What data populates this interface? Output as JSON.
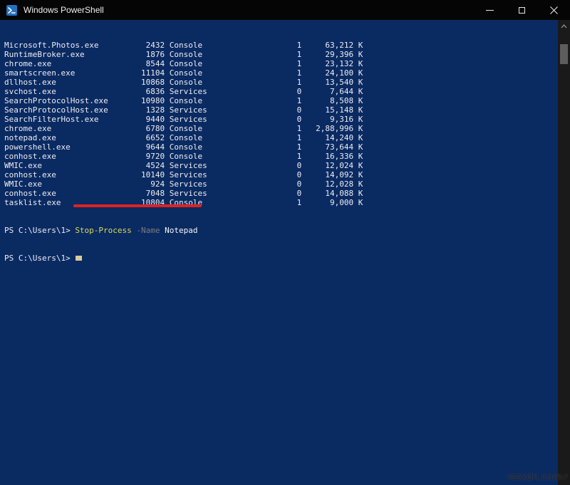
{
  "window": {
    "title": "Windows PowerShell"
  },
  "colors": {
    "console_background": "#0a2a62",
    "titlebar_background": "#050505",
    "console_text": "#eeedf0",
    "command_token": "#dcdc55",
    "parameter_token": "#7d7d7d",
    "argument_token": "#f7f7f7",
    "annotation_red": "#dd2222",
    "cursor": "#d9cb9b",
    "powershell_icon_blue": "#2671be"
  },
  "console": {
    "processes": [
      {
        "name": "Microsoft.Photos.exe",
        "pid": "2432",
        "session_name": "Console",
        "session_number": "1",
        "mem_usage": "63,212 K"
      },
      {
        "name": "RuntimeBroker.exe",
        "pid": "1876",
        "session_name": "Console",
        "session_number": "1",
        "mem_usage": "29,396 K"
      },
      {
        "name": "chrome.exe",
        "pid": "8544",
        "session_name": "Console",
        "session_number": "1",
        "mem_usage": "23,132 K"
      },
      {
        "name": "smartscreen.exe",
        "pid": "11104",
        "session_name": "Console",
        "session_number": "1",
        "mem_usage": "24,100 K"
      },
      {
        "name": "dllhost.exe",
        "pid": "10868",
        "session_name": "Console",
        "session_number": "1",
        "mem_usage": "13,540 K"
      },
      {
        "name": "svchost.exe",
        "pid": "6836",
        "session_name": "Services",
        "session_number": "0",
        "mem_usage": "7,644 K"
      },
      {
        "name": "SearchProtocolHost.exe",
        "pid": "10980",
        "session_name": "Console",
        "session_number": "1",
        "mem_usage": "8,508 K"
      },
      {
        "name": "SearchProtocolHost.exe",
        "pid": "1328",
        "session_name": "Services",
        "session_number": "0",
        "mem_usage": "15,148 K"
      },
      {
        "name": "SearchFilterHost.exe",
        "pid": "9440",
        "session_name": "Services",
        "session_number": "0",
        "mem_usage": "9,316 K"
      },
      {
        "name": "chrome.exe",
        "pid": "6780",
        "session_name": "Console",
        "session_number": "1",
        "mem_usage": "2,88,996 K"
      },
      {
        "name": "notepad.exe",
        "pid": "6652",
        "session_name": "Console",
        "session_number": "1",
        "mem_usage": "14,240 K"
      },
      {
        "name": "powershell.exe",
        "pid": "9644",
        "session_name": "Console",
        "session_number": "1",
        "mem_usage": "73,644 K"
      },
      {
        "name": "conhost.exe",
        "pid": "9720",
        "session_name": "Console",
        "session_number": "1",
        "mem_usage": "16,336 K"
      },
      {
        "name": "WMIC.exe",
        "pid": "4524",
        "session_name": "Services",
        "session_number": "0",
        "mem_usage": "12,024 K"
      },
      {
        "name": "conhost.exe",
        "pid": "10140",
        "session_name": "Services",
        "session_number": "0",
        "mem_usage": "14,092 K"
      },
      {
        "name": "WMIC.exe",
        "pid": "924",
        "session_name": "Services",
        "session_number": "0",
        "mem_usage": "12,028 K"
      },
      {
        "name": "conhost.exe",
        "pid": "7048",
        "session_name": "Services",
        "session_number": "0",
        "mem_usage": "14,088 K"
      },
      {
        "name": "tasklist.exe",
        "pid": "10804",
        "session_name": "Console",
        "session_number": "1",
        "mem_usage": "9,000 K"
      }
    ],
    "command_line": {
      "prompt": "PS C:\\Users\\1>",
      "command": "Stop-Process",
      "parameter": "-Name",
      "argument": "Notepad"
    },
    "current_prompt": "PS C:\\Users\\1>"
  },
  "watermark": {
    "text": "wsxdn.com",
    "mark": "✔"
  }
}
